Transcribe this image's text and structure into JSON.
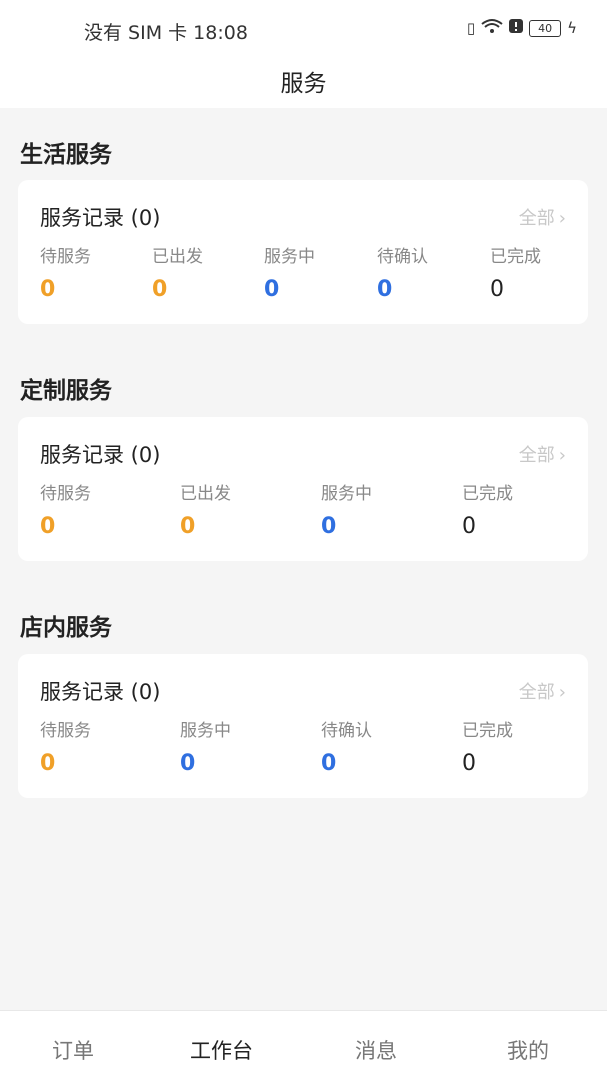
{
  "status_bar": {
    "carrier_time": "没有 SIM 卡 18:08",
    "battery": "40"
  },
  "header": {
    "title": "服务"
  },
  "sections": [
    {
      "title": "生活服务",
      "card": {
        "title": "服务记录 (0)",
        "all_label": "全部",
        "stats": [
          {
            "label": "待服务",
            "value": "0",
            "color": "#f0a028"
          },
          {
            "label": "已出发",
            "value": "0",
            "color": "#f0a028"
          },
          {
            "label": "服务中",
            "value": "0",
            "color": "#2f6fe0"
          },
          {
            "label": "待确认",
            "value": "0",
            "color": "#2f6fe0"
          },
          {
            "label": "已完成",
            "value": "0",
            "color": "#222222"
          }
        ]
      }
    },
    {
      "title": "定制服务",
      "card": {
        "title": "服务记录 (0)",
        "all_label": "全部",
        "stats": [
          {
            "label": "待服务",
            "value": "0",
            "color": "#f0a028"
          },
          {
            "label": "已出发",
            "value": "0",
            "color": "#f0a028"
          },
          {
            "label": "服务中",
            "value": "0",
            "color": "#2f6fe0"
          },
          {
            "label": "已完成",
            "value": "0",
            "color": "#222222"
          }
        ]
      }
    },
    {
      "title": "店内服务",
      "card": {
        "title": "服务记录 (0)",
        "all_label": "全部",
        "stats": [
          {
            "label": "待服务",
            "value": "0",
            "color": "#f0a028"
          },
          {
            "label": "服务中",
            "value": "0",
            "color": "#2f6fe0"
          },
          {
            "label": "待确认",
            "value": "0",
            "color": "#2f6fe0"
          },
          {
            "label": "已完成",
            "value": "0",
            "color": "#222222"
          }
        ]
      }
    }
  ],
  "tab_bar": {
    "tabs": [
      {
        "label": "订单",
        "active": false
      },
      {
        "label": "工作台",
        "active": true
      },
      {
        "label": "消息",
        "active": false
      },
      {
        "label": "我的",
        "active": false
      }
    ]
  }
}
